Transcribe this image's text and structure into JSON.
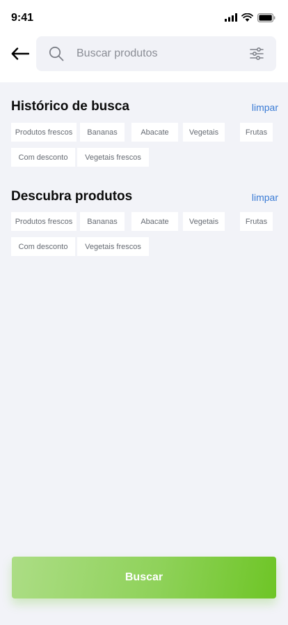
{
  "status_bar": {
    "time": "9:41"
  },
  "search": {
    "placeholder": "Buscar produtos",
    "value": ""
  },
  "icons": {
    "back": "arrow-left-icon",
    "search": "magnifier-icon",
    "filter": "sliders-icon"
  },
  "history": {
    "title": "Histórico de busca",
    "clear_label": "limpar",
    "chips": [
      "Produtos frescos",
      "Bananas",
      "Abacate",
      "Vegetais",
      "Frutas",
      "Com desconto",
      "Vegetais frescos"
    ]
  },
  "discover": {
    "title": "Descubra produtos",
    "clear_label": "limpar",
    "chips": [
      "Produtos frescos",
      "Bananas",
      "Abacate",
      "Vegetais",
      "Frutas",
      "Com desconto",
      "Vegetais frescos"
    ]
  },
  "cta": {
    "label": "Buscar"
  },
  "colors": {
    "accent_link": "#3a7bd5",
    "cta_start": "#acdd85",
    "cta_end": "#6ec526",
    "background": "#f2f3f8"
  }
}
